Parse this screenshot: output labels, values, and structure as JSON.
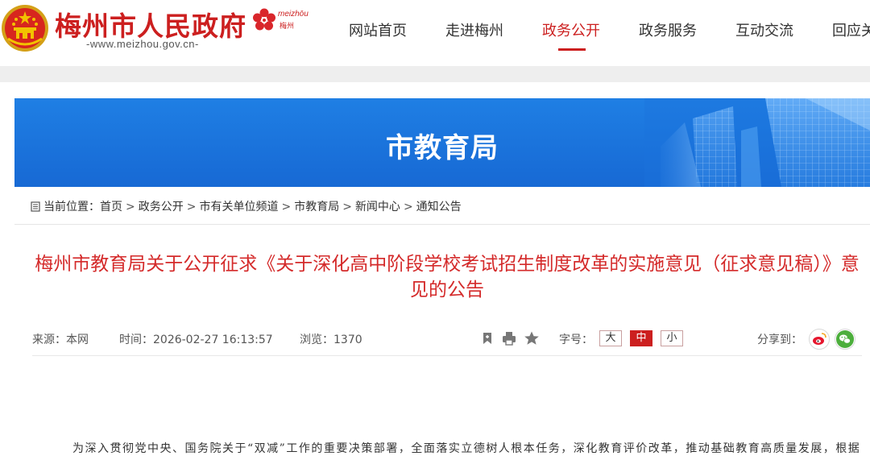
{
  "header": {
    "site_title": "梅州市人民政府",
    "site_url": "-www.meizhou.gov.cn-",
    "logo_en": "meizhōu",
    "logo_cn": "梅州",
    "nav": [
      {
        "label": "网站首页"
      },
      {
        "label": "走进梅州"
      },
      {
        "label": "政务公开",
        "active": true
      },
      {
        "label": "政务服务"
      },
      {
        "label": "互动交流"
      },
      {
        "label": "回应关切"
      }
    ]
  },
  "banner": {
    "title": "市教育局"
  },
  "breadcrumb": {
    "prefix": "当前位置：",
    "items": [
      "首页",
      "政务公开",
      "市有关单位频道",
      "市教育局",
      "新闻中心",
      "通知公告"
    ],
    "separator": ">"
  },
  "article": {
    "title": "梅州市教育局关于公开征求《关于深化高中阶段学校考试招生制度改革的实施意见（征求意见稿）》意见的公告",
    "source_label": "来源：本网",
    "time_label": "时间：2026-02-27 16:13:57",
    "views_label": "浏览：1370",
    "font_size_label": "字号：",
    "font_sizes": [
      "大",
      "中",
      "小"
    ],
    "active_font_size": "中",
    "share_label": "分享到：",
    "body_first_line": "为深入贯彻党中央、国务院关于“双减”工作的重要决策部署，全面落实立德树人根本任务，深化教育评价改革，推动基础教育高质量发展，根据"
  },
  "icons": {
    "bookmark": "bookmark-icon",
    "print": "print-icon",
    "favorite": "star-icon",
    "weibo": "weibo-icon",
    "wechat": "wechat-icon"
  },
  "colors": {
    "brand_red": "#cc1f1f",
    "title_red": "#d42a2a",
    "banner_blue": "#1f7fe4",
    "gray_strip": "#eeeeee",
    "weibo": "#e6162d",
    "wechat": "#4cae3c"
  }
}
